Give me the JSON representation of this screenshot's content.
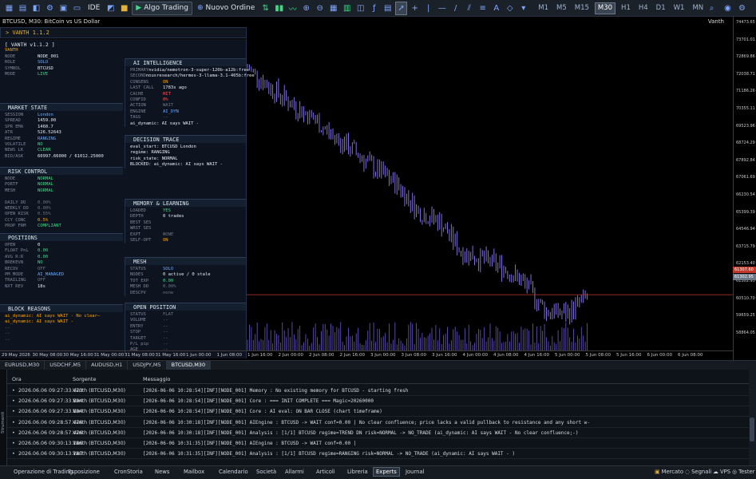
{
  "toolbar": {
    "algo_label": "Algo Trading",
    "new_order_label": "Nuovo Ordine",
    "ide_label": "IDE",
    "timeframes": [
      "M1",
      "M5",
      "M15",
      "M30",
      "H1",
      "H4",
      "D1",
      "W1",
      "MN"
    ],
    "selected_timeframe": "M30"
  },
  "chart": {
    "title": "BTCUSD, M30: BitCoin vs US Dollar",
    "user": "Vanth",
    "y_ticks": [
      "74473.65",
      "73701.01",
      "72869.86",
      "72038.71",
      "71186.26",
      "70355.11",
      "69523.96",
      "68724.29",
      "67892.84",
      "67061.69",
      "66230.54",
      "65399.39",
      "64546.94",
      "63715.79",
      "62153.40",
      "61302.95",
      "60510.70",
      "59659.25",
      "58864.05"
    ],
    "price_tag": "61307.60",
    "bid_tag": "61302.95",
    "x_ticks": [
      "29 May 2026",
      "30 May 08:00",
      "30 May 16:00",
      "31 May 00:00",
      "31 May 08:00",
      "31 May 16:00",
      "1 Jun 00:00",
      "1 Jun 08:00",
      "1 Jun 16:00",
      "2 Jun 00:00",
      "2 Jun 08:00",
      "2 Jun 16:00",
      "3 Jun 00:00",
      "3 Jun 08:00",
      "3 Jun 16:00",
      "4 Jun 00:00",
      "4 Jun 08:00",
      "4 Jun 16:00",
      "5 Jun 00:00",
      "5 Jun 08:00",
      "5 Jun 16:00",
      "6 Jun 00:00",
      "6 Jun 08:00"
    ],
    "accent_candle": "#8c7cf0",
    "price_line_color": "#c0392b"
  },
  "chart_data": {
    "type": "candlestick",
    "symbol": "BTCUSD",
    "timeframe": "M30",
    "x": [
      "1 Jun 00:00",
      "1 Jun 08:00",
      "1 Jun 16:00",
      "2 Jun 00:00",
      "2 Jun 08:00",
      "2 Jun 16:00",
      "3 Jun 00:00",
      "3 Jun 08:00",
      "3 Jun 16:00",
      "4 Jun 00:00",
      "4 Jun 08:00",
      "4 Jun 16:00",
      "5 Jun 00:00",
      "5 Jun 08:00",
      "5 Jun 16:00",
      "6 Jun 00:00",
      "6 Jun 08:00"
    ],
    "close_approx": [
      72200,
      71300,
      70500,
      69800,
      68900,
      68200,
      67300,
      66600,
      65300,
      64800,
      63400,
      63000,
      62600,
      61800,
      60500,
      60400,
      61300
    ],
    "ylim": [
      58864.05,
      74473.65
    ],
    "last_price": 61307.6
  },
  "hud": {
    "header": "VANTH 1.1.2",
    "title": "[ VANTH v1.1.2 ]",
    "brand": "VANTH",
    "node": {
      "label": "NODE",
      "value": "NODE_001"
    },
    "role": {
      "label": "ROLE",
      "value": "SOLO"
    },
    "symbol": {
      "label": "SYMBOL",
      "value": "BTCUSD"
    },
    "mode": {
      "label": "MODE",
      "value": "LIVE"
    },
    "market_state": {
      "title": "MARKET STATE",
      "rows": [
        {
          "k": "SESSION",
          "v": "London"
        },
        {
          "k": "SPREAD",
          "v": "1459.00"
        },
        {
          "k": "SPR EMA",
          "v": "1460.7"
        },
        {
          "k": "ATR",
          "v": "526.52643"
        },
        {
          "k": "REGIME",
          "v": "RANGING"
        },
        {
          "k": "VOLATILE",
          "v": "NO"
        },
        {
          "k": "NEWS LK",
          "v": "CLEAR"
        },
        {
          "k": "BID/ASK",
          "v": "60997.66000 / 61012.25000"
        }
      ]
    },
    "risk_control": {
      "title": "RISK CONTROL",
      "rows": [
        {
          "k": "NODE",
          "v": "NORMAL"
        },
        {
          "k": "PORTF",
          "v": "NORMAL"
        },
        {
          "k": "MESH",
          "v": "NORMAL"
        },
        {
          "k": "",
          "v": ""
        },
        {
          "k": "DAILY DD",
          "v": "0.00%"
        },
        {
          "k": "WEEKLY DD",
          "v": "0.00%"
        },
        {
          "k": "OPEN RISK",
          "v": "0.55%"
        },
        {
          "k": "CCY CONC",
          "v": "0.5%"
        },
        {
          "k": "PROP FRM",
          "v": "COMPLIANT"
        }
      ]
    },
    "positions": {
      "title": "POSITIONS",
      "rows": [
        {
          "k": "OPEN",
          "v": "0"
        },
        {
          "k": "FLOAT PnL",
          "v": "0.00"
        },
        {
          "k": "AVG R:R",
          "v": "0.00"
        },
        {
          "k": "BREKEVN",
          "v": "NO"
        },
        {
          "k": "RECOV",
          "v": "OFF"
        },
        {
          "k": "PM MODE",
          "v": "AI_MANAGED"
        },
        {
          "k": "TRAILING",
          "v": "OFF"
        },
        {
          "k": "NXT REV",
          "v": "18s"
        }
      ]
    },
    "block_reasons": {
      "title": "BLOCK REASONS",
      "lines": [
        "ai_dynamic: AI says WAIT - No clear—",
        "ai_dynamic: AI says WAIT -",
        "--",
        "--",
        "--"
      ]
    },
    "ai_intel": {
      "title": "AI INTELLIGENCE",
      "rows": [
        {
          "k": "PRIMARY",
          "v": "nvidia/nemotron-3-super-120b-a12b:free"
        },
        {
          "k": "SECOND",
          "v": "nousresearch/hermes-3-llama-3.1-405b:free"
        },
        {
          "k": "CONSENS",
          "v": "ON"
        },
        {
          "k": "LAST CALL",
          "v": "1783s ago"
        },
        {
          "k": "CACHE",
          "v": "HIT"
        },
        {
          "k": "CONFID",
          "v": "0%"
        },
        {
          "k": "ACTION",
          "v": "WAIT"
        },
        {
          "k": "ENGINE",
          "v": "AI_DYN"
        },
        {
          "k": "TAGS",
          "v": "--"
        },
        {
          "k": "",
          "v": "ai_dynamic: AI says WAIT -"
        }
      ]
    },
    "decision_trace": {
      "title": "DECISION TRACE",
      "lines": [
        "eval_start: BTCUSD London",
        "regime: RANGING",
        "risk_state: NORMAL",
        "BLOCKED: ai_dynamic: AI says WAIT -"
      ]
    },
    "memory": {
      "title": "MEMORY & LEARNING",
      "rows": [
        {
          "k": "LOADED",
          "v": "YES"
        },
        {
          "k": "DEPTH",
          "v": "0 trades"
        },
        {
          "k": "BEST SES",
          "v": ""
        },
        {
          "k": "WRST SES",
          "v": ""
        },
        {
          "k": "EXPT",
          "v": "NONE"
        },
        {
          "k": "SELF-OPT",
          "v": "ON"
        }
      ]
    },
    "mesh": {
      "title": "MESH",
      "rows": [
        {
          "k": "STATUS",
          "v": "SOLO"
        },
        {
          "k": "NODES",
          "v": "0 active / 0 stale"
        },
        {
          "k": "TOT EXP",
          "v": "0.00"
        },
        {
          "k": "MESH DD",
          "v": "0.00%"
        },
        {
          "k": "DESCPV",
          "v": "none"
        }
      ]
    },
    "open_position": {
      "title": "OPEN POSITION",
      "rows": [
        {
          "k": "STATUS",
          "v": "FLAT"
        },
        {
          "k": "VOLUME",
          "v": "--"
        },
        {
          "k": "ENTRY",
          "v": "--"
        },
        {
          "k": "STOP",
          "v": "--"
        },
        {
          "k": "TARGET",
          "v": "--"
        },
        {
          "k": "P/L pip",
          "v": "--"
        },
        {
          "k": "AGE",
          "v": "--"
        }
      ]
    }
  },
  "symbol_tabs": [
    "EURUSD,M30",
    "USDCHF,M5",
    "AUDUSD,H1",
    "USDJPY,M5",
    "BTCUSD,M30"
  ],
  "active_symbol_tab": 4,
  "terminal": {
    "side_label": "Strumenti",
    "headers": {
      "time": "Ora",
      "source": "Sorgente",
      "message": "Messaggio"
    },
    "rows": [
      {
        "time": "2026.06.06 09:27:33.473",
        "source": "Vanth (BTCUSD,M30)",
        "message": "[2026-06-06 10:28:54][INF][NODE_001] Memory : No existing memory for BTCUSD - starting fresh"
      },
      {
        "time": "2026.06.06 09:27:33.894",
        "source": "Vanth (BTCUSD,M30)",
        "message": "[2026-06-06 10:28:54][INF][NODE_001] Core : === INIT COMPLETE === Magic=20260000"
      },
      {
        "time": "2026.06.06 09:27:33.894",
        "source": "Vanth (BTCUSD,M30)",
        "message": "[2026-06-06 10:28:54][INF][NODE_001] Core : AI eval: ON BAR CLOSE (chart timeframe)"
      },
      {
        "time": "2026.06.06 09:28:57.476",
        "source": "Vanth (BTCUSD,M30)",
        "message": "[2026-06-06 10:30:18][INF][NODE_001] AIEngine : BTCUSD -> WAIT conf=0.00 | No clear confluence; price lacks a valid pullback to resistance and any short w-"
      },
      {
        "time": "2026.06.06 09:28:57.476",
        "source": "Vanth (BTCUSD,M30)",
        "message": "[2026-06-06 10:30:18][INF][NODE_001] Analysis : [1/1] BTCUSD regime=TREND DN risk=NORMAL -> NO_TRADE (ai_dynamic: AI says WAIT - No clear confluence;-)"
      },
      {
        "time": "2026.06.06 09:30:13.186",
        "source": "Vanth (BTCUSD,M30)",
        "message": "[2026-06-06 10:31:35][INF][NODE_001] AIEngine : BTCUSD -> WAIT conf=0.00 |"
      },
      {
        "time": "2026.06.06 09:30:13.187",
        "source": "Vanth (BTCUSD,M30)",
        "message": "[2026-06-06 10:31:35][INF][NODE_001] Analysis : [1/1] BTCUSD regime=RANGING risk=NORMAL -> NO_TRADE (ai_dynamic: AI says WAIT - )"
      }
    ]
  },
  "bottom_tabs": [
    "Operazione di Trading",
    "Esposizione",
    "CronStoria",
    "News",
    "Mailbox",
    "Calendario",
    "Società",
    "Allarmi",
    "Articoli",
    "Libreria",
    "Experts",
    "Journal"
  ],
  "active_bottom_tab": 10,
  "status_right": {
    "market": "Mercato",
    "signals": "Segnali",
    "vps": "VPS",
    "tester": "Tester"
  }
}
